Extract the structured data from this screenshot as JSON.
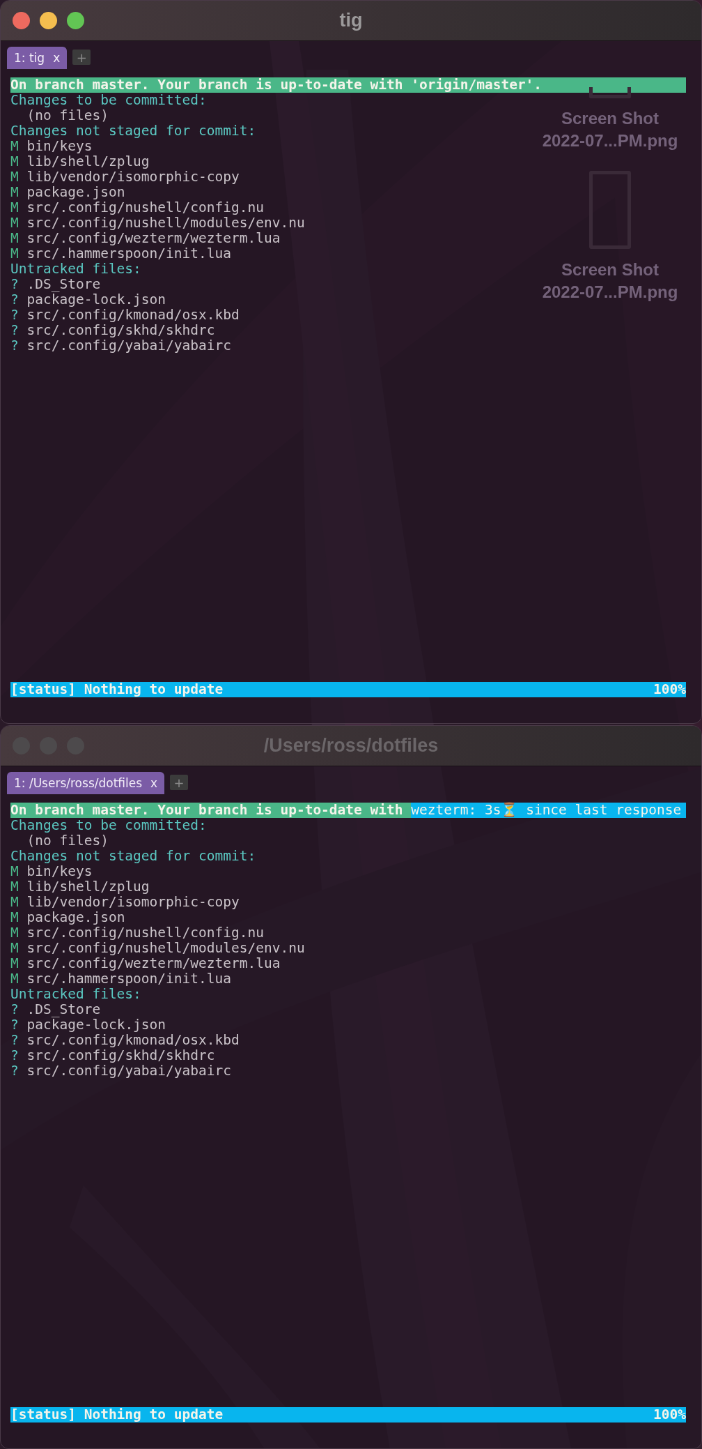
{
  "desktop_files": [
    {
      "label_lines": [
        "Screen Shot",
        "2022-07...PM.png"
      ]
    },
    {
      "label_lines": [
        "Screen Shot",
        "2022-07...PM.png"
      ]
    }
  ],
  "windows": [
    {
      "title": "tig",
      "active": true,
      "tabs": [
        {
          "label": "1: tig",
          "close": "x",
          "selected": true
        }
      ],
      "new_tab": "+",
      "lines": [
        {
          "kind": "header",
          "segments": [
            {
              "kind": "green",
              "text": "On branch master. Your branch is up-to-date with 'origin/master'."
            }
          ]
        },
        {
          "kind": "section",
          "text": "Changes to be committed:"
        },
        {
          "kind": "note",
          "text": "  (no files)"
        },
        {
          "kind": "section",
          "text": "Changes not staged for commit:"
        },
        {
          "kind": "modified",
          "status": "M",
          "text": "bin/keys"
        },
        {
          "kind": "modified",
          "status": "M",
          "text": "lib/shell/zplug"
        },
        {
          "kind": "modified",
          "status": "M",
          "text": "lib/vendor/isomorphic-copy"
        },
        {
          "kind": "modified",
          "status": "M",
          "text": "package.json"
        },
        {
          "kind": "modified",
          "status": "M",
          "text": "src/.config/nushell/config.nu"
        },
        {
          "kind": "modified",
          "status": "M",
          "text": "src/.config/nushell/modules/env.nu"
        },
        {
          "kind": "modified",
          "status": "M",
          "text": "src/.config/wezterm/wezterm.lua"
        },
        {
          "kind": "modified",
          "status": "M",
          "text": "src/.hammerspoon/init.lua"
        },
        {
          "kind": "section",
          "text": "Untracked files:"
        },
        {
          "kind": "untracked",
          "status": "?",
          "text": ".DS_Store"
        },
        {
          "kind": "untracked",
          "status": "?",
          "text": "package-lock.json"
        },
        {
          "kind": "untracked",
          "status": "?",
          "text": "src/.config/kmonad/osx.kbd"
        },
        {
          "kind": "untracked",
          "status": "?",
          "text": "src/.config/skhd/skhdrc"
        },
        {
          "kind": "untracked",
          "status": "?",
          "text": "src/.config/yabai/yabairc"
        }
      ],
      "status": {
        "text": "[status] Nothing to update",
        "percent": "100%"
      }
    },
    {
      "title": "/Users/ross/dotfiles",
      "active": false,
      "tabs": [
        {
          "label": "1: /Users/ross/dotfiles",
          "close": "x",
          "selected": true
        }
      ],
      "new_tab": "+",
      "lines": [
        {
          "kind": "header",
          "segments": [
            {
              "kind": "green",
              "text": "On branch master. Your branch is up-to-date with "
            },
            {
              "kind": "blue",
              "text": "wezterm: 3s⏳ since last response"
            }
          ]
        },
        {
          "kind": "section",
          "text": "Changes to be committed:"
        },
        {
          "kind": "note",
          "text": "  (no files)"
        },
        {
          "kind": "section",
          "text": "Changes not staged for commit:"
        },
        {
          "kind": "modified",
          "status": "M",
          "text": "bin/keys"
        },
        {
          "kind": "modified",
          "status": "M",
          "text": "lib/shell/zplug"
        },
        {
          "kind": "modified",
          "status": "M",
          "text": "lib/vendor/isomorphic-copy"
        },
        {
          "kind": "modified",
          "status": "M",
          "text": "package.json"
        },
        {
          "kind": "modified",
          "status": "M",
          "text": "src/.config/nushell/config.nu"
        },
        {
          "kind": "modified",
          "status": "M",
          "text": "src/.config/nushell/modules/env.nu"
        },
        {
          "kind": "modified",
          "status": "M",
          "text": "src/.config/wezterm/wezterm.lua"
        },
        {
          "kind": "modified",
          "status": "M",
          "text": "src/.hammerspoon/init.lua"
        },
        {
          "kind": "section",
          "text": "Untracked files:"
        },
        {
          "kind": "untracked",
          "status": "?",
          "text": ".DS_Store"
        },
        {
          "kind": "untracked",
          "status": "?",
          "text": "package-lock.json"
        },
        {
          "kind": "untracked",
          "status": "?",
          "text": "src/.config/kmonad/osx.kbd"
        },
        {
          "kind": "untracked",
          "status": "?",
          "text": "src/.config/skhd/skhdrc"
        },
        {
          "kind": "untracked",
          "status": "?",
          "text": "src/.config/yabai/yabairc"
        }
      ],
      "status": {
        "text": "[status] Nothing to update",
        "percent": "100%"
      }
    }
  ]
}
